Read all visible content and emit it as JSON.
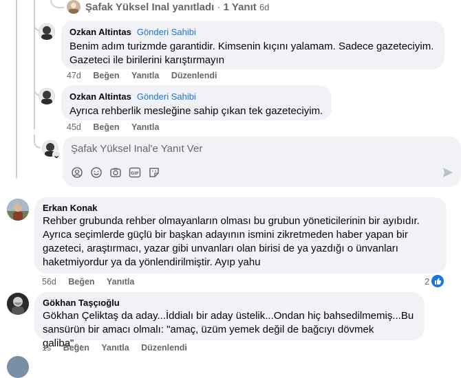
{
  "top_reply": {
    "name": "Şafak Yüksel Inal",
    "action": "yanıtladı",
    "dot": "·",
    "count": "1 Yanıt",
    "time": "6d"
  },
  "comments": [
    {
      "author": "Ozkan Altintas",
      "badge": "Gönderi Sahibi",
      "lines": [
        "Benim adım turizmde garantidir. Kimsenin kıçını yalamam. Sadece gazeteciyim.",
        "Gazeteci ile birilerini karıştırmayın"
      ],
      "time": "47d",
      "like": "Beğen",
      "reply": "Yanıtla",
      "edited": "Düzenlendi"
    },
    {
      "author": "Ozkan Altintas",
      "badge": "Gönderi Sahibi",
      "lines": [
        "Ayrıca rehberlik mesleğine sahip çıkan tek gazeteciyim."
      ],
      "time": "45d",
      "like": "Beğen",
      "reply": "Yanıtla"
    }
  ],
  "reply_box": {
    "placeholder": "Şafak Yüksel Inal'e Yanıt Ver",
    "tools": [
      "avatar-sticker-icon",
      "emoji-icon",
      "camera-icon",
      "gif-icon",
      "sticker-icon"
    ],
    "send_icon": "send-icon"
  },
  "top_comments": [
    {
      "author": "Erkan Konak",
      "lines": [
        "Rehber grubunda rehber olmayanların olması bu grubun yöneticilerinin bir ayıbıdır.",
        "Ayrıca seçimlerde güçlü bir başkan adayının ismini zikretmeden haber yapan bir",
        "gazeteci, araştırmacı, yazar gibi unvanları olan birisi de ya yazdığı o ünvanları",
        "haketmiyordur ya da yönlendirilmiştir. Ayıp yahu"
      ],
      "time": "56d",
      "like": "Beğen",
      "reply": "Yanıtla",
      "reactions": "2"
    },
    {
      "author": "Gökhan Taşçıoğlu",
      "lines": [
        "Gökhan Çeliktaş da aday...İddialı bir aday üstelik...Ondan hiç bahsedilmemiş...Bu",
        "sansürün bir amacı olmalı: \"amaç, üzüm yemek değil de bağcıyı dövmek galiba\"..."
      ],
      "time": "1s",
      "like": "Beğen",
      "reply": "Yanıtla",
      "edited": "Düzenlendi"
    }
  ],
  "colors": {
    "bubble": "#f0f2f5",
    "link": "#1b74e4",
    "meta": "#65676b",
    "thread": "#ced0d4"
  }
}
